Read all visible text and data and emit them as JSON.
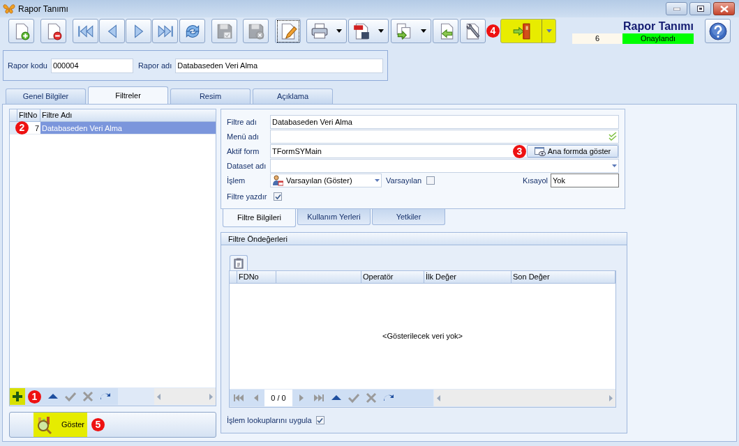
{
  "window": {
    "title": "Rapor Tanımı"
  },
  "toolbar": {
    "buttons": [
      {
        "disabled": false,
        "dropdown": false,
        "highlighted": false,
        "focused": false
      },
      {
        "disabled": false,
        "dropdown": false,
        "highlighted": false,
        "focused": false
      },
      {
        "disabled": false,
        "dropdown": false,
        "highlighted": false,
        "focused": false
      },
      {
        "disabled": false,
        "dropdown": false,
        "highlighted": false,
        "focused": false
      },
      {
        "disabled": false,
        "dropdown": false,
        "highlighted": false,
        "focused": false
      },
      {
        "disabled": false,
        "dropdown": false,
        "highlighted": false,
        "focused": false
      },
      {
        "disabled": false,
        "dropdown": false,
        "highlighted": false,
        "focused": false
      },
      {
        "disabled": true,
        "dropdown": false,
        "highlighted": false,
        "focused": false
      },
      {
        "disabled": true,
        "dropdown": false,
        "highlighted": false,
        "focused": false
      },
      {
        "disabled": false,
        "dropdown": false,
        "highlighted": false,
        "focused": true
      },
      {
        "disabled": false,
        "dropdown": true,
        "highlighted": false,
        "focused": false
      },
      {
        "disabled": false,
        "dropdown": true,
        "highlighted": false,
        "focused": false
      },
      {
        "disabled": false,
        "dropdown": true,
        "highlighted": false,
        "focused": false
      },
      {
        "disabled": false,
        "dropdown": false,
        "highlighted": false,
        "focused": false
      },
      {
        "disabled": false,
        "dropdown": false,
        "highlighted": false,
        "focused": false
      },
      {
        "disabled": false,
        "dropdown": true,
        "highlighted": true,
        "focused": false,
        "callout": "4"
      }
    ]
  },
  "status": {
    "title": "Rapor Tanımı",
    "number": "6",
    "state": "Onaylandı"
  },
  "header": {
    "fields": [
      {
        "label": "Rapor kodu",
        "value": "000004"
      },
      {
        "label": "Rapor adı",
        "value": "Databaseden Veri Alma"
      }
    ]
  },
  "tabs": [
    {
      "label": "Genel Bilgiler",
      "selected": false
    },
    {
      "label": "Filtreler",
      "selected": true
    },
    {
      "label": "Resim",
      "selected": false
    },
    {
      "label": "Açıklama",
      "selected": false
    }
  ],
  "filter_list": {
    "columns": [
      "FltNo",
      "Filtre Adı"
    ],
    "rows": [
      {
        "cells": [
          "7",
          "Databaseden Veri Alma"
        ],
        "selected": true,
        "callout": "2"
      }
    ],
    "navigator": {
      "callout": "1",
      "highlighted": true,
      "buttons": [
        {
          "disabled": false
        },
        {
          "disabled": true
        },
        {
          "disabled": true
        },
        {
          "disabled": false
        }
      ]
    }
  },
  "show_button": {
    "label": "Göster",
    "callout": "5",
    "highlighted": true
  },
  "filter_form": {
    "filter_name": {
      "label": "Filtre adı",
      "value": "Databaseden Veri Alma"
    },
    "menu_name": {
      "label": "Menü adı"
    },
    "active_form": {
      "label": "Aktif form",
      "value": "TFormSYMain",
      "button": "Ana formda göster",
      "callout": "3"
    },
    "dataset_name": {
      "label": "Dataset adı"
    },
    "operation": {
      "label": "İşlem",
      "value": "Varsayılan (Göster)"
    },
    "default": {
      "label": "Varsayılan",
      "checked": false
    },
    "shortcut": {
      "label": "Kısayol",
      "value": "Yok"
    },
    "print_filter": {
      "label": "Filtre yazdır",
      "checked": true
    }
  },
  "subtabs": [
    {
      "label": "Filtre Bilgileri",
      "selected": true
    },
    {
      "label": "Kullanım Yerleri",
      "selected": false
    },
    {
      "label": "Yetkiler",
      "selected": false
    }
  ],
  "defaults": {
    "title": "Filtre Öndeğerleri",
    "columns": [
      {
        "kind": "header",
        "label": "FDNo"
      },
      {
        "kind": "blank"
      },
      {
        "kind": "header",
        "label": "Operatör"
      },
      {
        "kind": "header",
        "label": "İlk Değer"
      },
      {
        "kind": "header",
        "label": "Son Değer"
      }
    ],
    "empty_text": "<Gösterilecek veri yok>",
    "navigator": {
      "position": "0 / 0",
      "buttons": [
        {
          "disabled": true
        },
        {
          "disabled": true
        },
        {
          "disabled": true
        },
        {
          "disabled": true
        },
        {
          "disabled": false
        },
        {
          "disabled": true
        },
        {
          "disabled": true
        },
        {
          "disabled": false
        }
      ]
    },
    "apply_lookups": {
      "label": "İşlem lookuplarını uygula",
      "checked": true
    }
  }
}
